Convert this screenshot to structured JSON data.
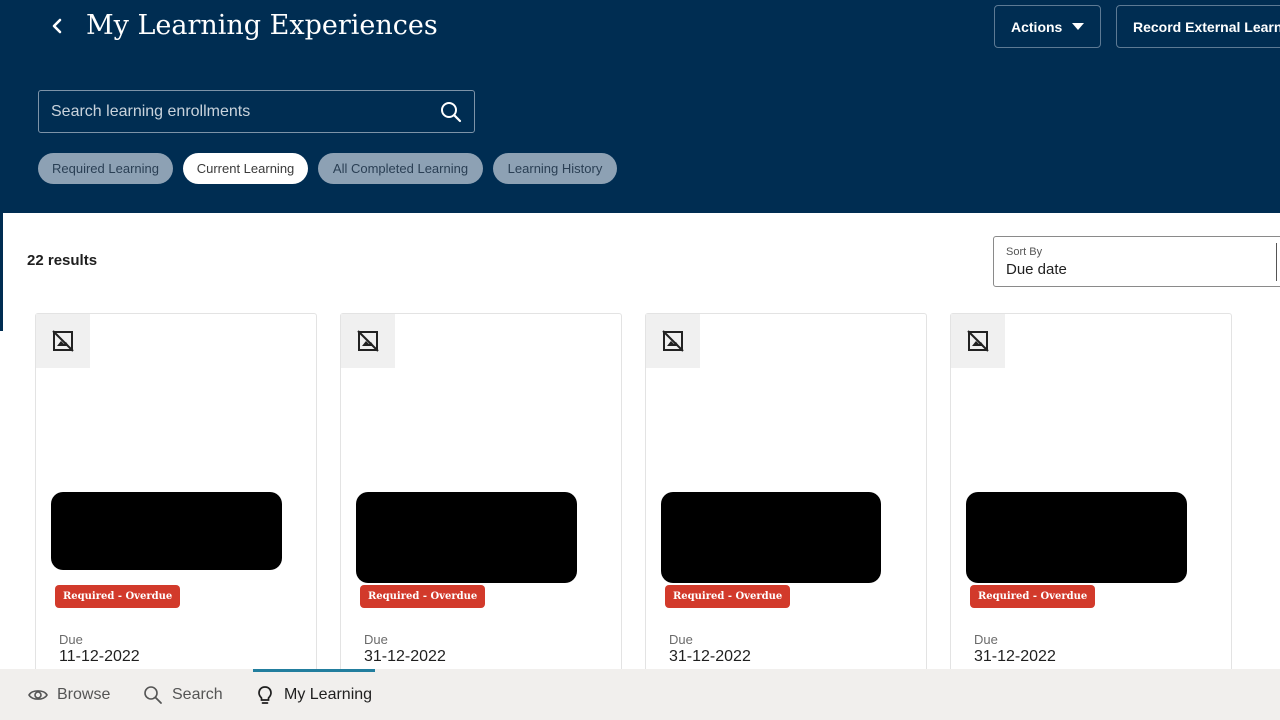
{
  "header": {
    "title": "My Learning Experiences",
    "actions_label": "Actions",
    "record_label": "Record External Learning"
  },
  "search": {
    "placeholder": "Search learning enrollments"
  },
  "filters": [
    {
      "label": "Required Learning",
      "active": false
    },
    {
      "label": "Current Learning",
      "active": true
    },
    {
      "label": "All Completed Learning",
      "active": false
    },
    {
      "label": "Learning History",
      "active": false
    }
  ],
  "results": {
    "count_text": "22 results"
  },
  "sort": {
    "label": "Sort By",
    "value": "Due date"
  },
  "cards": [
    {
      "badge": "Required - Overdue",
      "due_label": "Due",
      "due_date": "11-12-2022"
    },
    {
      "badge": "Required - Overdue",
      "due_label": "Due",
      "due_date": "31-12-2022"
    },
    {
      "badge": "Required - Overdue",
      "due_label": "Due",
      "due_date": "31-12-2022"
    },
    {
      "badge": "Required - Overdue",
      "due_label": "Due",
      "due_date": "31-12-2022"
    }
  ],
  "bottom_nav": [
    {
      "label": "Browse",
      "icon": "eye-icon",
      "active": false
    },
    {
      "label": "Search",
      "icon": "search-icon",
      "active": false
    },
    {
      "label": "My Learning",
      "icon": "lightbulb-icon",
      "active": true
    }
  ],
  "colors": {
    "header_bg": "#002d52",
    "badge_red": "#d23a2b",
    "nav_indicator": "#227e9e"
  }
}
